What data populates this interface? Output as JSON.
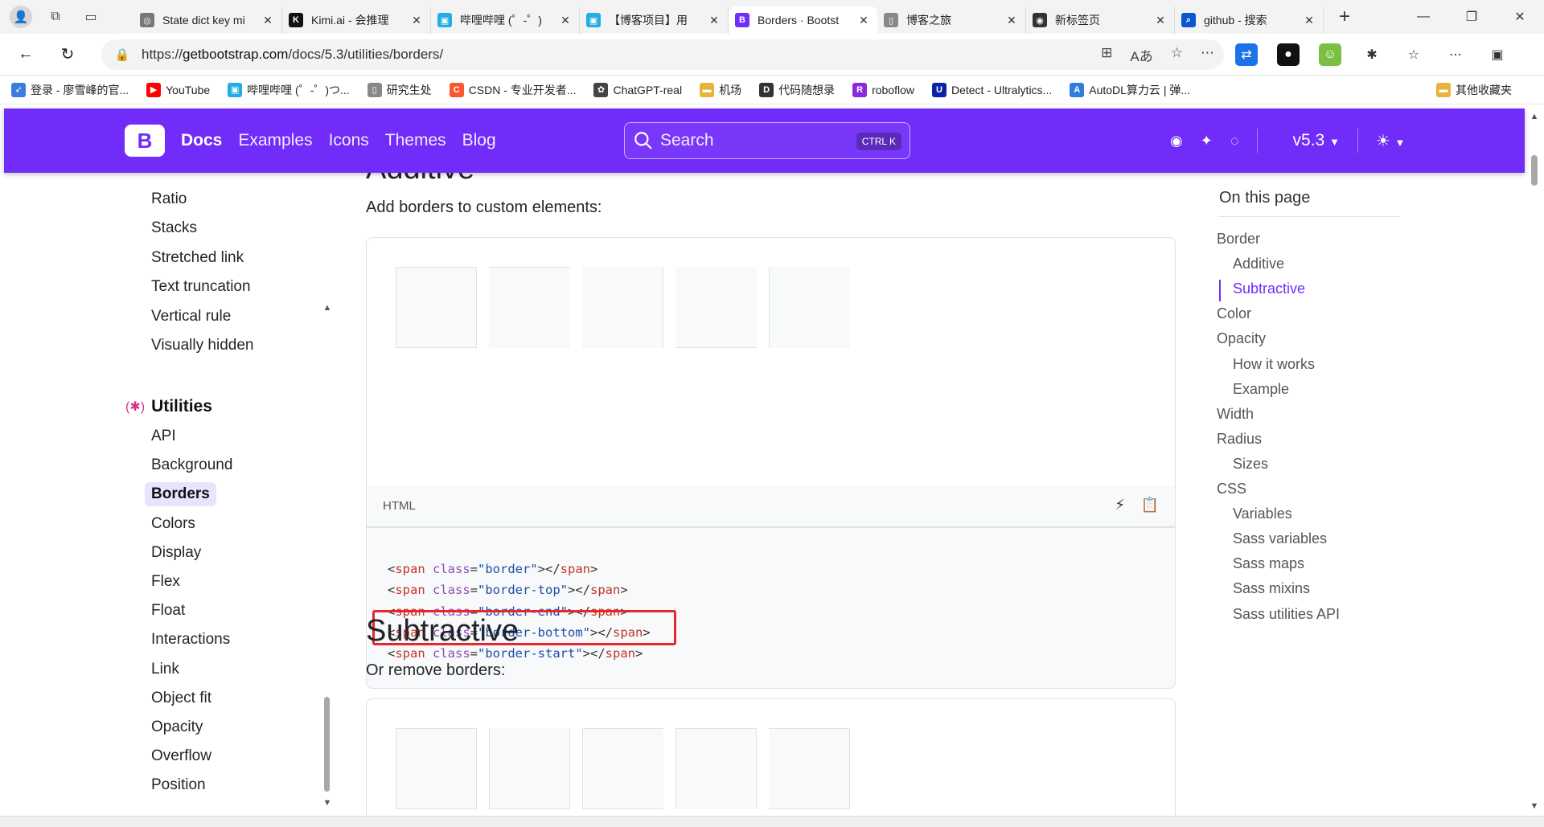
{
  "browser": {
    "tabs": [
      {
        "title": "State dict key mi",
        "icon": "globe-icon",
        "color": "#777777",
        "active": false
      },
      {
        "title": "Kimi.ai - 会推理",
        "icon": "kimi-icon",
        "color": "#111111",
        "active": false
      },
      {
        "title": "哔哩哔哩 (゜-゜)",
        "icon": "bilibili-icon",
        "color": "#23ade5",
        "active": false
      },
      {
        "title": "【博客项目】用",
        "icon": "bilibili-icon",
        "color": "#23ade5",
        "active": false
      },
      {
        "title": "Borders · Bootst",
        "icon": "bootstrap-icon",
        "color": "#712cf9",
        "active": true
      },
      {
        "title": "博客之旅",
        "icon": "page-icon",
        "color": "#888888",
        "active": false
      },
      {
        "title": "新标签页",
        "icon": "github-icon",
        "color": "#333333",
        "active": false
      },
      {
        "title": "github - 搜索",
        "icon": "search-icon",
        "color": "#0b57d0",
        "active": false
      }
    ],
    "url_prefix": "https://",
    "url_host": "getbootstrap.com",
    "url_path": "/docs/5.3/utilities/borders/",
    "bookmarks": [
      {
        "label": "登录 - 廖雪峰的官...",
        "icon": "rocket-icon",
        "color": "#3b7ddd"
      },
      {
        "label": "YouTube",
        "icon": "youtube-icon",
        "color": "#ff0000"
      },
      {
        "label": "哔哩哔哩 (゜-゜)つ...",
        "icon": "bilibili-icon",
        "color": "#23ade5"
      },
      {
        "label": "研究生处",
        "icon": "page-icon",
        "color": "#888888"
      },
      {
        "label": "CSDN - 专业开发者...",
        "icon": "csdn-icon",
        "color": "#fc5531"
      },
      {
        "label": "ChatGPT-real",
        "icon": "openai-icon",
        "color": "#444444"
      },
      {
        "label": "机场",
        "icon": "folder-icon",
        "color": "#e8b33a"
      },
      {
        "label": "代码随想录",
        "icon": "code-icon",
        "color": "#333333"
      },
      {
        "label": "roboflow",
        "icon": "roboflow-icon",
        "color": "#8a2be2"
      },
      {
        "label": "Detect - Ultralytics...",
        "icon": "ultralytics-icon",
        "color": "#0b23a9"
      },
      {
        "label": "AutoDL算力云 | 弹...",
        "icon": "autodl-icon",
        "color": "#2f7de1"
      }
    ],
    "other_bookmarks": "其他收藏夹"
  },
  "bootstrap_nav": {
    "logo": "B",
    "links": [
      "Docs",
      "Examples",
      "Icons",
      "Themes",
      "Blog"
    ],
    "search_placeholder": "Search",
    "search_kbd": "CTRL K",
    "version": "v5.3"
  },
  "sidebar": {
    "partial_top": "Position",
    "items_before": [
      "Ratio",
      "Stacks",
      "Stretched link",
      "Text truncation",
      "Vertical rule",
      "Visually hidden"
    ],
    "section": "Utilities",
    "items": [
      "API",
      "Background",
      "Borders",
      "Colors",
      "Display",
      "Flex",
      "Float",
      "Interactions",
      "Link",
      "Object fit",
      "Opacity",
      "Overflow",
      "Position"
    ],
    "active": "Borders"
  },
  "main": {
    "heading_additive": "Additive",
    "additive_text": "Add borders to custom elements:",
    "code_lang": "HTML",
    "code_lines": [
      {
        "cls": "border"
      },
      {
        "cls": "border-top"
      },
      {
        "cls": "border-end"
      },
      {
        "cls": "border-bottom"
      },
      {
        "cls": "border-start"
      }
    ],
    "code_tag_open": "<span",
    "code_attr": " class=",
    "code_tag_close": "></span>",
    "heading_subtractive": "Subtractive",
    "subtractive_text": "Or remove borders:"
  },
  "toc": {
    "title": "On this page",
    "items": [
      {
        "label": "Border",
        "level": 1
      },
      {
        "label": "Additive",
        "level": 2
      },
      {
        "label": "Subtractive",
        "level": 2,
        "active": true
      },
      {
        "label": "Color",
        "level": 1
      },
      {
        "label": "Opacity",
        "level": 1
      },
      {
        "label": "How it works",
        "level": 2
      },
      {
        "label": "Example",
        "level": 2
      },
      {
        "label": "Width",
        "level": 1
      },
      {
        "label": "Radius",
        "level": 1
      },
      {
        "label": "Sizes",
        "level": 2
      },
      {
        "label": "CSS",
        "level": 1
      },
      {
        "label": "Variables",
        "level": 2
      },
      {
        "label": "Sass variables",
        "level": 2
      },
      {
        "label": "Sass maps",
        "level": 2
      },
      {
        "label": "Sass mixins",
        "level": 2
      },
      {
        "label": "Sass utilities API",
        "level": 2
      }
    ]
  },
  "colors": {
    "bootstrap_purple": "#712cf9",
    "highlight_red": "#e8262b"
  }
}
